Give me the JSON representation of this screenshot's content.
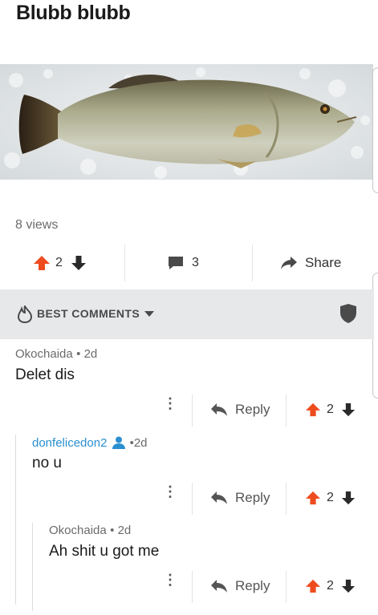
{
  "post": {
    "title": "Blubb blubb",
    "views": "8 views",
    "upvotes": "2",
    "comment_count": "3",
    "share_label": "Share"
  },
  "comments_header": {
    "label": "BEST COMMENTS"
  },
  "comments": [
    {
      "author": "Okochaida",
      "age": "2d",
      "body": "Delet dis",
      "reply_label": "Reply",
      "votes": "2"
    },
    {
      "author": "donfelicedon2",
      "age": "2d",
      "body": "no u",
      "reply_label": "Reply",
      "votes": "2"
    },
    {
      "author": "Okochaida",
      "age": "2d",
      "body": "Ah shit u got me",
      "reply_label": "Reply",
      "votes": "2"
    }
  ],
  "colors": {
    "upvote": "#ee4b1e",
    "author_link": "#2a8fcf",
    "header_bg": "#e6e8ea"
  }
}
